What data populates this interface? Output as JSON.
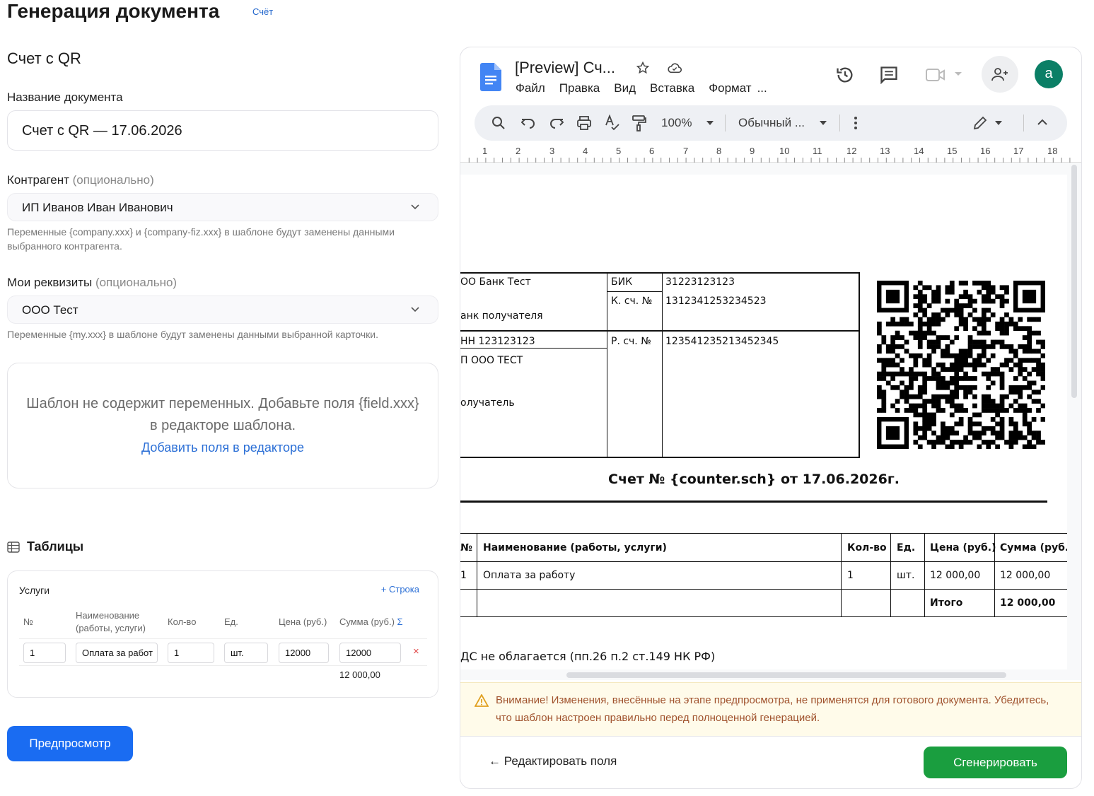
{
  "header": {
    "title": "Генерация документа",
    "badge": "Счёт"
  },
  "form": {
    "doc_heading": "Счет с QR",
    "name_label": "Название документа",
    "name_value": "Счет с QR — 17.06.2026",
    "contractor_label": "Контрагент",
    "contractor_optional": "(опционально)",
    "contractor_value": "ИП Иванов Иван Иванович",
    "contractor_hint": "Переменные {company.xxx} и {company-fiz.xxx} в шаблоне будут заменены данными выбранного контрагента.",
    "requisites_label": "Мои реквизиты",
    "requisites_optional": "(опционально)",
    "requisites_value": "ООО Тест",
    "requisites_hint": "Переменные {my.xxx} в шаблоне будут заменены данными выбранной карточки.",
    "empty_text": "Шаблон не содержит переменных. Добавьте поля {field.xxx} в редакторе шаблона.",
    "empty_link": "Добавить поля в редакторе",
    "tables_heading": "Таблицы",
    "preview_button": "Предпросмотр"
  },
  "services": {
    "title": "Услуги",
    "add_row": "+ Строка",
    "headers": [
      "№",
      "Наименование (работы, услуги)",
      "Кол-во",
      "Ед.",
      "Цена (руб.)",
      "Сумма (руб.)"
    ],
    "sigma": "Σ",
    "row": {
      "num": "1",
      "name": "Оплата за работ",
      "qty": "1",
      "unit": "шт.",
      "price": "12000",
      "sum": "12000"
    },
    "total": "12 000,00",
    "delete_glyph": "×"
  },
  "gdocs": {
    "title": "[Preview] Сч...",
    "menu": [
      "Файл",
      "Правка",
      "Вид",
      "Вставка",
      "Формат",
      "..."
    ],
    "avatar_letter": "a",
    "zoom": "100%",
    "style": "Обычный ...",
    "ruler": [
      "1",
      "2",
      "3",
      "4",
      "5",
      "6",
      "7",
      "8",
      "9",
      "10",
      "11",
      "12",
      "13",
      "14",
      "15",
      "16",
      "17",
      "18"
    ]
  },
  "invoice": {
    "bank_name": "ОО Банк Тест",
    "bank_label": "анк получателя",
    "bik_label": "БИК",
    "bik_value": "31223123123",
    "ks_label": "К. сч. №",
    "ks_value": "1312341253234523",
    "inn": "НН 123123123",
    "recipient_name": "П ООО ТЕСТ",
    "recipient_label": "олучатель",
    "rs_label": "Р. сч. №",
    "rs_value": "123541235213452345",
    "title": "Счет № {counter.sch} от 17.06.2026г.",
    "table_headers": [
      "№",
      "Наименование (работы, услуги)",
      "Кол-во",
      "Ед.",
      "Цена (руб.)",
      "Сумма (руб.)"
    ],
    "row": [
      "1",
      "Оплата за работу",
      "1",
      "шт.",
      "12 000,00",
      "12 000,00"
    ],
    "total_label": "Итого",
    "total_value": "12 000,00",
    "vat_note": "ДС не облагается (пп.26 п.2 ст.149 НК РФ)"
  },
  "warning": {
    "text": "Внимание! Изменения, внесённые на этапе предпросмотра, не применятся для готового документа. Убедитесь, что шаблон настроен правильно перед полноценной генерацией."
  },
  "footer": {
    "back_link": "← Редактировать поля",
    "generate_button": "Сгенерировать"
  },
  "colors": {
    "primary": "#1a6cf2",
    "success": "#1a9e3f",
    "link": "#2b6fd6",
    "warning_text": "#a0522d"
  }
}
